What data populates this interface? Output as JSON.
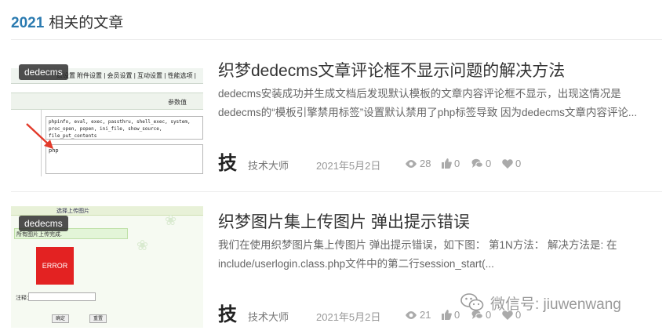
{
  "section": {
    "year": "2021",
    "title": "相关的文章"
  },
  "posts": [
    {
      "category": "dedecms",
      "title": "织梦dedecms文章评论框不显示问题的解决方法",
      "excerpt": "dedecms安装成功并生成文档后发现默认模板的文章内容评论框不显示，出现这情况是dedecms的“模板引擎禁用标签”设置默认禁用了php标签导致 因为dedecms文章内容评论...",
      "author_logo": "技",
      "author": "技术大师",
      "date": "2021年5月2日",
      "views": "28",
      "likes": "0",
      "comments": "0",
      "favorites": "0",
      "thumb": {
        "menu": "附件设置 | 会员设置 | 互动设置 | 性能选项 |",
        "menu_left": "数设置",
        "header": "参数值",
        "box1": "phpinfo, eval, exec, passthru, shell_exec, system, proc_open, popen, ini_file, show_source, file_put_contents",
        "box2": "php"
      }
    },
    {
      "category": "dedecms",
      "title": "织梦图片集上传图片 弹出提示错误",
      "excerpt": "我们在使用织梦图片集上传图片 弹出提示错误，如下图： 第1N方法： 解决方法是: 在include/userlogin.class.php文件中的第二行session_start(...",
      "author_logo": "技",
      "author": "技术大师",
      "date": "2021年5月2日",
      "views": "21",
      "likes": "0",
      "comments": "0",
      "favorites": "0",
      "thumb": {
        "topbar": "选择上传图片",
        "status": "所有图片上传完成.",
        "error": "ERROR",
        "label": "注释：",
        "btn_ok": "确定",
        "btn_reset": "重置"
      }
    }
  ],
  "watermark": "微信号: jiuwenwang"
}
